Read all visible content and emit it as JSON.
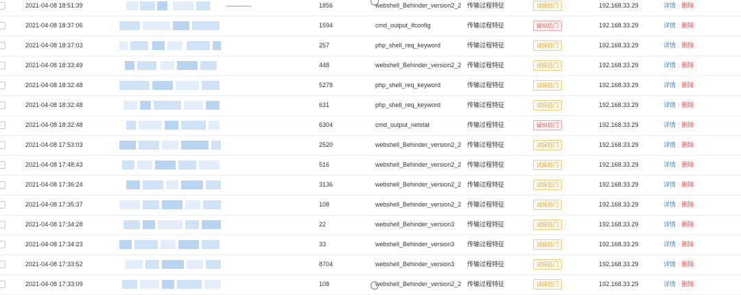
{
  "rows": [
    {
      "time": "2021-04-08 18:51:39",
      "count": "1856",
      "rule": "webshell_Behinder_version2_2",
      "type": "传输过程特征",
      "tag": "试探后门",
      "tag_kind": "probe",
      "ip": "192.168.33.29",
      "detail": "详情",
      "delete": "删除"
    },
    {
      "time": "2021-04-08 18:37:06",
      "count": "1594",
      "rule": "cmd_output_ifconfig",
      "type": "传输过程特征",
      "tag": "疑似后门",
      "tag_kind": "suspect",
      "ip": "192.168.33.29",
      "detail": "详情",
      "delete": "删除"
    },
    {
      "time": "2021-04-08 18:37:03",
      "count": "257",
      "rule": "php_shell_req_keyword",
      "type": "传输过程特征",
      "tag": "试探后门",
      "tag_kind": "probe",
      "ip": "192.168.33.29",
      "detail": "详情",
      "delete": "删除"
    },
    {
      "time": "2021-04-08 18:33:49",
      "count": "448",
      "rule": "webshell_Behinder_version2_2",
      "type": "传输过程特征",
      "tag": "试探后门",
      "tag_kind": "probe",
      "ip": "192.168.33.29",
      "detail": "详情",
      "delete": "删除"
    },
    {
      "time": "2021-04-08 18:32:48",
      "count": "5278",
      "rule": "php_shell_req_keyword",
      "type": "传输过程特征",
      "tag": "试探后门",
      "tag_kind": "probe",
      "ip": "192.168.33.29",
      "detail": "详情",
      "delete": "删除"
    },
    {
      "time": "2021-04-08 18:32:48",
      "count": "631",
      "rule": "php_shell_req_keyword",
      "type": "传输过程特征",
      "tag": "试探后门",
      "tag_kind": "probe",
      "ip": "192.168.33.29",
      "detail": "详情",
      "delete": "删除"
    },
    {
      "time": "2021-04-08 18:32:48",
      "count": "6304",
      "rule": "cmd_output_netstat",
      "type": "传输过程特征",
      "tag": "疑似后门",
      "tag_kind": "suspect",
      "ip": "192.168.33.29",
      "detail": "详情",
      "delete": "删除"
    },
    {
      "time": "2021-04-08 17:53:03",
      "count": "2520",
      "rule": "webshell_Behinder_version2_2",
      "type": "传输过程特征",
      "tag": "试探后门",
      "tag_kind": "probe",
      "ip": "192.168.33.29",
      "detail": "详情",
      "delete": "删除"
    },
    {
      "time": "2021-04-08 17:48:43",
      "count": "516",
      "rule": "webshell_Behinder_version2_2",
      "type": "传输过程特征",
      "tag": "试探后门",
      "tag_kind": "probe",
      "ip": "192.168.33.29",
      "detail": "详情",
      "delete": "删除"
    },
    {
      "time": "2021-04-08 17:36:24",
      "count": "3136",
      "rule": "webshell_Behinder_version2_2",
      "type": "传输过程特征",
      "tag": "试探后门",
      "tag_kind": "probe",
      "ip": "192.168.33.29",
      "detail": "详情",
      "delete": "删除"
    },
    {
      "time": "2021-04-08 17:35:37",
      "count": "108",
      "rule": "webshell_Behinder_version2_2",
      "type": "传输过程特征",
      "tag": "试探后门",
      "tag_kind": "probe",
      "ip": "192.168.33.29",
      "detail": "详情",
      "delete": "删除"
    },
    {
      "time": "2021-04-08 17:34:28",
      "count": "22",
      "rule": "webshell_Behinder_version3",
      "type": "传输过程特征",
      "tag": "试探后门",
      "tag_kind": "probe",
      "ip": "192.168.33.29",
      "detail": "详情",
      "delete": "删除"
    },
    {
      "time": "2021-04-08 17:34:23",
      "count": "33",
      "rule": "webshell_Behinder_version3",
      "type": "传输过程特征",
      "tag": "试探后门",
      "tag_kind": "probe",
      "ip": "192.168.33.29",
      "detail": "详情",
      "delete": "删除"
    },
    {
      "time": "2021-04-08 17:33:52",
      "count": "8704",
      "rule": "webshell_Behinder_version3",
      "type": "传输过程特征",
      "tag": "试探后门",
      "tag_kind": "probe",
      "ip": "192.168.33.29",
      "detail": "详情",
      "delete": "删除"
    },
    {
      "time": "2021-04-08 17:33:09",
      "count": "108",
      "rule": "webshell_Behinder_version2_2",
      "type": "传输过程特征",
      "tag": "试探后门",
      "tag_kind": "probe",
      "ip": "192.168.33.29",
      "detail": "详情",
      "delete": "删除"
    }
  ]
}
